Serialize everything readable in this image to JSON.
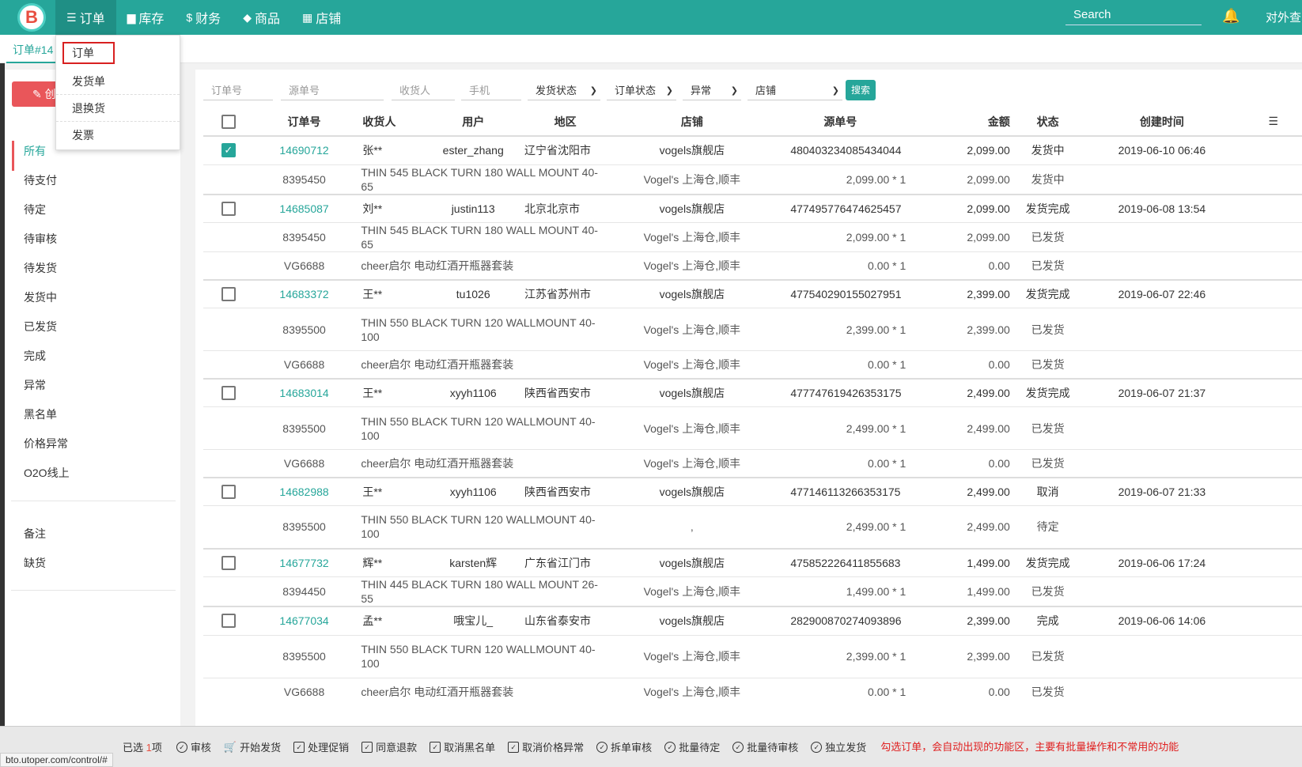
{
  "nav": {
    "logo": "B",
    "items": [
      {
        "label": "订单",
        "icon": "list-icon"
      },
      {
        "label": "库存",
        "icon": "box-icon"
      },
      {
        "label": "财务",
        "icon": "dollar-icon"
      },
      {
        "label": "商品",
        "icon": "layers-icon"
      },
      {
        "label": "店铺",
        "icon": "store-icon"
      }
    ],
    "search_placeholder": "Search",
    "external": "对外查"
  },
  "tabstrip": {
    "active_tab": "订单#14"
  },
  "dropdown": {
    "items": [
      "订单",
      "发货单",
      "退换货",
      "发票"
    ]
  },
  "sidebar": {
    "create": "创建",
    "items": [
      "所有",
      "待支付",
      "待定",
      "待审核",
      "待发货",
      "发货中",
      "已发货",
      "完成",
      "异常",
      "黑名单",
      "价格异常",
      "O2O线上"
    ],
    "items2": [
      "备注",
      "缺货"
    ]
  },
  "filters": {
    "order_no": "订单号",
    "source_no": "源单号",
    "receiver": "收货人",
    "phone": "手机",
    "ship_status": "发货状态",
    "order_status": "订单状态",
    "exception": "异常",
    "shop": "店铺",
    "search_btn": "搜索"
  },
  "table": {
    "headers": [
      "订单号",
      "收货人",
      "用户",
      "地区",
      "店铺",
      "源单号",
      "金额",
      "状态",
      "创建时间"
    ],
    "rows": [
      {
        "type": "order",
        "checked": true,
        "id": "14690712",
        "receiver": "张**",
        "user": "ester_zhang",
        "region": "辽宁省沈阳市",
        "shop": "vogels旗舰店",
        "source": "480403234085434044",
        "amount": "2,099.00",
        "status": "发货中",
        "time": "2019-06-10 06:46"
      },
      {
        "type": "item",
        "sku": "8395450",
        "name": "THIN 545 BLACK TURN 180 WALL MOUNT 40-65",
        "wh": "Vogel's 上海仓,顺丰",
        "price": "2,099.00 * 1",
        "amount": "2,099.00",
        "status": "发货中"
      },
      {
        "type": "order",
        "checked": false,
        "id": "14685087",
        "receiver": "刘**",
        "user": "justin113",
        "region": "北京北京市",
        "shop": "vogels旗舰店",
        "source": "477495776474625457",
        "amount": "2,099.00",
        "status": "发货完成",
        "time": "2019-06-08 13:54"
      },
      {
        "type": "item",
        "sku": "8395450",
        "name": "THIN 545 BLACK TURN 180 WALL MOUNT 40-65",
        "wh": "Vogel's 上海仓,顺丰",
        "price": "2,099.00 * 1",
        "amount": "2,099.00",
        "status": "已发货"
      },
      {
        "type": "item",
        "sku": "VG6688",
        "name": "cheer启尔 电动红酒开瓶器套装",
        "wh": "Vogel's 上海仓,顺丰",
        "price": "0.00 * 1",
        "amount": "0.00",
        "status": "已发货"
      },
      {
        "type": "order",
        "checked": false,
        "id": "14683372",
        "receiver": "王**",
        "user": "tu1026",
        "region": "江苏省苏州市",
        "shop": "vogels旗舰店",
        "source": "477540290155027951",
        "amount": "2,399.00",
        "status": "发货完成",
        "time": "2019-06-07 22:46"
      },
      {
        "type": "item",
        "tall": true,
        "sku": "8395500",
        "name": "THIN 550 BLACK TURN 120 WALLMOUNT 40-100",
        "wh": "Vogel's 上海仓,顺丰",
        "price": "2,399.00 * 1",
        "amount": "2,399.00",
        "status": "已发货"
      },
      {
        "type": "item",
        "sku": "VG6688",
        "name": "cheer启尔 电动红酒开瓶器套装",
        "wh": "Vogel's 上海仓,顺丰",
        "price": "0.00 * 1",
        "amount": "0.00",
        "status": "已发货"
      },
      {
        "type": "order",
        "checked": false,
        "id": "14683014",
        "receiver": "王**",
        "user": "xyyh1106",
        "region": "陕西省西安市",
        "shop": "vogels旗舰店",
        "source": "477747619426353175",
        "amount": "2,499.00",
        "status": "发货完成",
        "time": "2019-06-07 21:37"
      },
      {
        "type": "item",
        "tall": true,
        "sku": "8395500",
        "name": "THIN 550 BLACK TURN 120 WALLMOUNT 40-100",
        "wh": "Vogel's 上海仓,顺丰",
        "price": "2,499.00 * 1",
        "amount": "2,499.00",
        "status": "已发货"
      },
      {
        "type": "item",
        "sku": "VG6688",
        "name": "cheer启尔 电动红酒开瓶器套装",
        "wh": "Vogel's 上海仓,顺丰",
        "price": "0.00 * 1",
        "amount": "0.00",
        "status": "已发货"
      },
      {
        "type": "order",
        "checked": false,
        "id": "14682988",
        "receiver": "王**",
        "user": "xyyh1106",
        "region": "陕西省西安市",
        "shop": "vogels旗舰店",
        "source": "477146113266353175",
        "amount": "2,499.00",
        "status": "取消",
        "time": "2019-06-07 21:33"
      },
      {
        "type": "item",
        "tall": true,
        "sku": "8395500",
        "name": "THIN 550 BLACK TURN 120 WALLMOUNT 40-100",
        "wh": ",",
        "price": "2,499.00 * 1",
        "amount": "2,499.00",
        "status": "待定"
      },
      {
        "type": "order",
        "checked": false,
        "id": "14677732",
        "receiver": "辉**",
        "user": "karsten辉",
        "region": "广东省江门市",
        "shop": "vogels旗舰店",
        "source": "475852226411855683",
        "amount": "1,499.00",
        "status": "发货完成",
        "time": "2019-06-06 17:24"
      },
      {
        "type": "item",
        "sku": "8394450",
        "name": "THIN 445 BLACK TURN 180 WALL MOUNT 26-55",
        "wh": "Vogel's 上海仓,顺丰",
        "price": "1,499.00 * 1",
        "amount": "1,499.00",
        "status": "已发货"
      },
      {
        "type": "order",
        "checked": false,
        "id": "14677034",
        "receiver": "孟**",
        "user": "哦宝儿_",
        "region": "山东省泰安市",
        "shop": "vogels旗舰店",
        "source": "282900870274093896",
        "amount": "2,399.00",
        "status": "完成",
        "time": "2019-06-06 14:06"
      },
      {
        "type": "item",
        "tall": true,
        "sku": "8395500",
        "name": "THIN 550 BLACK TURN 120 WALLMOUNT 40-100",
        "wh": "Vogel's 上海仓,顺丰",
        "price": "2,399.00 * 1",
        "amount": "2,399.00",
        "status": "已发货"
      },
      {
        "type": "item",
        "sku": "VG6688",
        "name": "cheer启尔 电动红酒开瓶器套装",
        "wh": "Vogel's 上海仓,顺丰",
        "price": "0.00 * 1",
        "amount": "0.00",
        "status": "已发货"
      }
    ]
  },
  "bottombar": {
    "selected_prefix": "已选",
    "selected_count": "1",
    "selected_suffix": "项",
    "actions": [
      "审核",
      "开始发货",
      "处理促销",
      "同意退款",
      "取消黑名单",
      "取消价格异常",
      "拆单审核",
      "批量待定",
      "批量待审核",
      "独立发货"
    ],
    "hint": "勾选订单，会自动出现的功能区，主要有批量操作和不常用的功能"
  },
  "status_url": "bto.utoper.com/control/#",
  "colors": {
    "primary": "#26a69a",
    "danger": "#e9565a",
    "hint": "#e02020"
  }
}
